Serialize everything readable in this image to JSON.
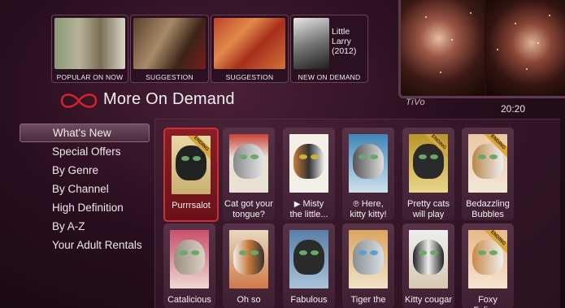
{
  "thumbs": [
    {
      "caption": "POPULAR ON NOW"
    },
    {
      "caption": "SUGGESTION"
    },
    {
      "caption": "SUGGESTION"
    },
    {
      "caption": "NEW ON DEMAND",
      "title_line1": "Little",
      "title_line2": "Larry",
      "title_line3": "(2012)"
    }
  ],
  "header": {
    "title": "More On Demand",
    "brand_mark": "TiVo",
    "time": "20:20"
  },
  "menu": [
    "What's New",
    "Special Offers",
    "By Genre",
    "By Channel",
    "High Definition",
    "By A-Z",
    "Your Adult Rentals"
  ],
  "tiles_row1": [
    {
      "l1": "Purrrsalot",
      "l2": "",
      "ribbon": "ENDING"
    },
    {
      "l1": "Cat got your",
      "l2": "tongue?",
      "ribbon": ""
    },
    {
      "l1": "Misty",
      "l2": "the little...",
      "ribbon": "",
      "prefix": "▶"
    },
    {
      "l1": "Here,",
      "l2": "kitty kitty!",
      "ribbon": "",
      "prefix": "℗"
    },
    {
      "l1": "Pretty cats",
      "l2": "will play",
      "ribbon": "ENDING"
    },
    {
      "l1": "Bedazzling",
      "l2": "Bubbles",
      "ribbon": "ENDING"
    }
  ],
  "tiles_row2": [
    {
      "l1": "Catalicious"
    },
    {
      "l1": "Oh so"
    },
    {
      "l1": "Fabulous"
    },
    {
      "l1": "Tiger the"
    },
    {
      "l1": "Kitty cougar"
    },
    {
      "l1": "Foxy Felines",
      "ribbon": "ENDING"
    }
  ],
  "colors": {
    "accent": "#c8303a",
    "background": "#2a0f1e",
    "ribbon": "#d8a73a"
  }
}
